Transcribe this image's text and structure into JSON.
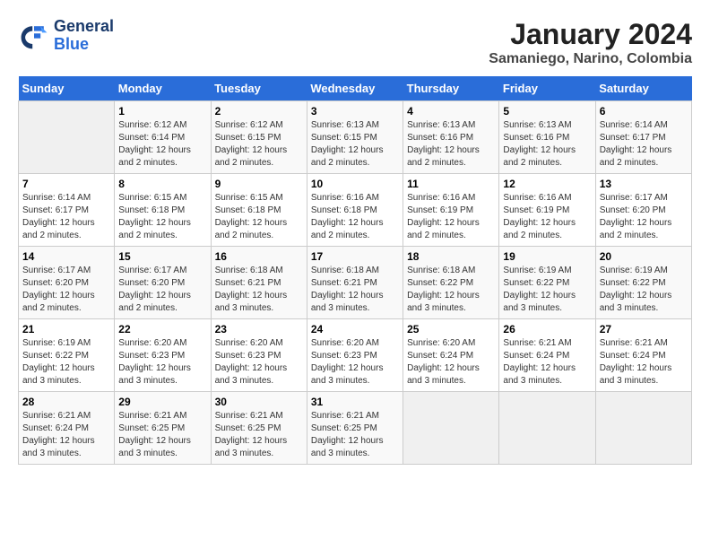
{
  "header": {
    "logo_line1": "General",
    "logo_line2": "Blue",
    "title": "January 2024",
    "subtitle": "Samaniego, Narino, Colombia"
  },
  "calendar": {
    "days_of_week": [
      "Sunday",
      "Monday",
      "Tuesday",
      "Wednesday",
      "Thursday",
      "Friday",
      "Saturday"
    ],
    "weeks": [
      [
        {
          "day": "",
          "sunrise": "",
          "sunset": "",
          "daylight": "",
          "empty": true
        },
        {
          "day": "1",
          "sunrise": "Sunrise: 6:12 AM",
          "sunset": "Sunset: 6:14 PM",
          "daylight": "Daylight: 12 hours and 2 minutes."
        },
        {
          "day": "2",
          "sunrise": "Sunrise: 6:12 AM",
          "sunset": "Sunset: 6:15 PM",
          "daylight": "Daylight: 12 hours and 2 minutes."
        },
        {
          "day": "3",
          "sunrise": "Sunrise: 6:13 AM",
          "sunset": "Sunset: 6:15 PM",
          "daylight": "Daylight: 12 hours and 2 minutes."
        },
        {
          "day": "4",
          "sunrise": "Sunrise: 6:13 AM",
          "sunset": "Sunset: 6:16 PM",
          "daylight": "Daylight: 12 hours and 2 minutes."
        },
        {
          "day": "5",
          "sunrise": "Sunrise: 6:13 AM",
          "sunset": "Sunset: 6:16 PM",
          "daylight": "Daylight: 12 hours and 2 minutes."
        },
        {
          "day": "6",
          "sunrise": "Sunrise: 6:14 AM",
          "sunset": "Sunset: 6:17 PM",
          "daylight": "Daylight: 12 hours and 2 minutes."
        }
      ],
      [
        {
          "day": "7",
          "sunrise": "Sunrise: 6:14 AM",
          "sunset": "Sunset: 6:17 PM",
          "daylight": "Daylight: 12 hours and 2 minutes."
        },
        {
          "day": "8",
          "sunrise": "Sunrise: 6:15 AM",
          "sunset": "Sunset: 6:18 PM",
          "daylight": "Daylight: 12 hours and 2 minutes."
        },
        {
          "day": "9",
          "sunrise": "Sunrise: 6:15 AM",
          "sunset": "Sunset: 6:18 PM",
          "daylight": "Daylight: 12 hours and 2 minutes."
        },
        {
          "day": "10",
          "sunrise": "Sunrise: 6:16 AM",
          "sunset": "Sunset: 6:18 PM",
          "daylight": "Daylight: 12 hours and 2 minutes."
        },
        {
          "day": "11",
          "sunrise": "Sunrise: 6:16 AM",
          "sunset": "Sunset: 6:19 PM",
          "daylight": "Daylight: 12 hours and 2 minutes."
        },
        {
          "day": "12",
          "sunrise": "Sunrise: 6:16 AM",
          "sunset": "Sunset: 6:19 PM",
          "daylight": "Daylight: 12 hours and 2 minutes."
        },
        {
          "day": "13",
          "sunrise": "Sunrise: 6:17 AM",
          "sunset": "Sunset: 6:20 PM",
          "daylight": "Daylight: 12 hours and 2 minutes."
        }
      ],
      [
        {
          "day": "14",
          "sunrise": "Sunrise: 6:17 AM",
          "sunset": "Sunset: 6:20 PM",
          "daylight": "Daylight: 12 hours and 2 minutes."
        },
        {
          "day": "15",
          "sunrise": "Sunrise: 6:17 AM",
          "sunset": "Sunset: 6:20 PM",
          "daylight": "Daylight: 12 hours and 2 minutes."
        },
        {
          "day": "16",
          "sunrise": "Sunrise: 6:18 AM",
          "sunset": "Sunset: 6:21 PM",
          "daylight": "Daylight: 12 hours and 3 minutes."
        },
        {
          "day": "17",
          "sunrise": "Sunrise: 6:18 AM",
          "sunset": "Sunset: 6:21 PM",
          "daylight": "Daylight: 12 hours and 3 minutes."
        },
        {
          "day": "18",
          "sunrise": "Sunrise: 6:18 AM",
          "sunset": "Sunset: 6:22 PM",
          "daylight": "Daylight: 12 hours and 3 minutes."
        },
        {
          "day": "19",
          "sunrise": "Sunrise: 6:19 AM",
          "sunset": "Sunset: 6:22 PM",
          "daylight": "Daylight: 12 hours and 3 minutes."
        },
        {
          "day": "20",
          "sunrise": "Sunrise: 6:19 AM",
          "sunset": "Sunset: 6:22 PM",
          "daylight": "Daylight: 12 hours and 3 minutes."
        }
      ],
      [
        {
          "day": "21",
          "sunrise": "Sunrise: 6:19 AM",
          "sunset": "Sunset: 6:22 PM",
          "daylight": "Daylight: 12 hours and 3 minutes."
        },
        {
          "day": "22",
          "sunrise": "Sunrise: 6:20 AM",
          "sunset": "Sunset: 6:23 PM",
          "daylight": "Daylight: 12 hours and 3 minutes."
        },
        {
          "day": "23",
          "sunrise": "Sunrise: 6:20 AM",
          "sunset": "Sunset: 6:23 PM",
          "daylight": "Daylight: 12 hours and 3 minutes."
        },
        {
          "day": "24",
          "sunrise": "Sunrise: 6:20 AM",
          "sunset": "Sunset: 6:23 PM",
          "daylight": "Daylight: 12 hours and 3 minutes."
        },
        {
          "day": "25",
          "sunrise": "Sunrise: 6:20 AM",
          "sunset": "Sunset: 6:24 PM",
          "daylight": "Daylight: 12 hours and 3 minutes."
        },
        {
          "day": "26",
          "sunrise": "Sunrise: 6:21 AM",
          "sunset": "Sunset: 6:24 PM",
          "daylight": "Daylight: 12 hours and 3 minutes."
        },
        {
          "day": "27",
          "sunrise": "Sunrise: 6:21 AM",
          "sunset": "Sunset: 6:24 PM",
          "daylight": "Daylight: 12 hours and 3 minutes."
        }
      ],
      [
        {
          "day": "28",
          "sunrise": "Sunrise: 6:21 AM",
          "sunset": "Sunset: 6:24 PM",
          "daylight": "Daylight: 12 hours and 3 minutes."
        },
        {
          "day": "29",
          "sunrise": "Sunrise: 6:21 AM",
          "sunset": "Sunset: 6:25 PM",
          "daylight": "Daylight: 12 hours and 3 minutes."
        },
        {
          "day": "30",
          "sunrise": "Sunrise: 6:21 AM",
          "sunset": "Sunset: 6:25 PM",
          "daylight": "Daylight: 12 hours and 3 minutes."
        },
        {
          "day": "31",
          "sunrise": "Sunrise: 6:21 AM",
          "sunset": "Sunset: 6:25 PM",
          "daylight": "Daylight: 12 hours and 3 minutes."
        },
        {
          "day": "",
          "sunrise": "",
          "sunset": "",
          "daylight": "",
          "empty": true
        },
        {
          "day": "",
          "sunrise": "",
          "sunset": "",
          "daylight": "",
          "empty": true
        },
        {
          "day": "",
          "sunrise": "",
          "sunset": "",
          "daylight": "",
          "empty": true
        }
      ]
    ]
  }
}
